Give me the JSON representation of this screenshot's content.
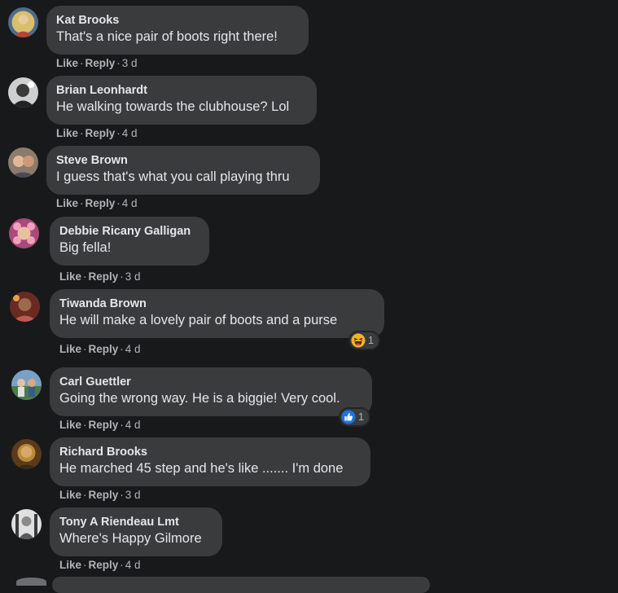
{
  "comments": [
    {
      "author": "Kat Brooks",
      "text": "That's a nice pair of boots right there!",
      "like": "Like",
      "reply": "Reply",
      "time": "3 d",
      "avatar_colors": [
        "#d7c06b",
        "#4f6b8a"
      ]
    },
    {
      "author": "Brian Leonhardt",
      "text": "He walking towards the clubhouse? Lol",
      "like": "Like",
      "reply": "Reply",
      "time": "4 d",
      "avatar_colors": [
        "#cfcfcf",
        "#222222"
      ]
    },
    {
      "author": "Steve Brown",
      "text": "I guess that's what you call playing thru",
      "like": "Like",
      "reply": "Reply",
      "time": "4 d",
      "avatar_colors": [
        "#c99a7a",
        "#8c7b6a"
      ]
    },
    {
      "author": "Debbie Ricany Galligan",
      "text": "Big fella!",
      "like": "Like",
      "reply": "Reply",
      "time": "3 d",
      "avatar_colors": [
        "#d87aa8",
        "#a84a7a"
      ]
    },
    {
      "author": "Tiwanda Brown",
      "text": "He will make a lovely pair of boots and a purse",
      "like": "Like",
      "reply": "Reply",
      "time": "4 d",
      "avatar_colors": [
        "#b0524a",
        "#6a2a24"
      ],
      "reaction": {
        "icon": "haha-reaction-icon",
        "count": "1"
      }
    },
    {
      "author": "Carl Guettler",
      "text": "Going the wrong way. He is a biggie! Very cool.",
      "like": "Like",
      "reply": "Reply",
      "time": "4 d",
      "avatar_colors": [
        "#7aa0c8",
        "#4a7a4a"
      ],
      "reaction": {
        "icon": "like-reaction-icon",
        "count": "1"
      }
    },
    {
      "author": "Richard Brooks",
      "text": "He marched 45 step and he's like ....... I'm done",
      "like": "Like",
      "reply": "Reply",
      "time": "3 d",
      "avatar_colors": [
        "#b88a3a",
        "#5a3a1a"
      ]
    },
    {
      "author": "Tony A Riendeau Lmt",
      "text": "Where's Happy Gilmore",
      "like": "Like",
      "reply": "Reply",
      "time": "4 d",
      "avatar_colors": [
        "#e0e0e0",
        "#3a3a3a"
      ]
    }
  ],
  "separator": "·"
}
